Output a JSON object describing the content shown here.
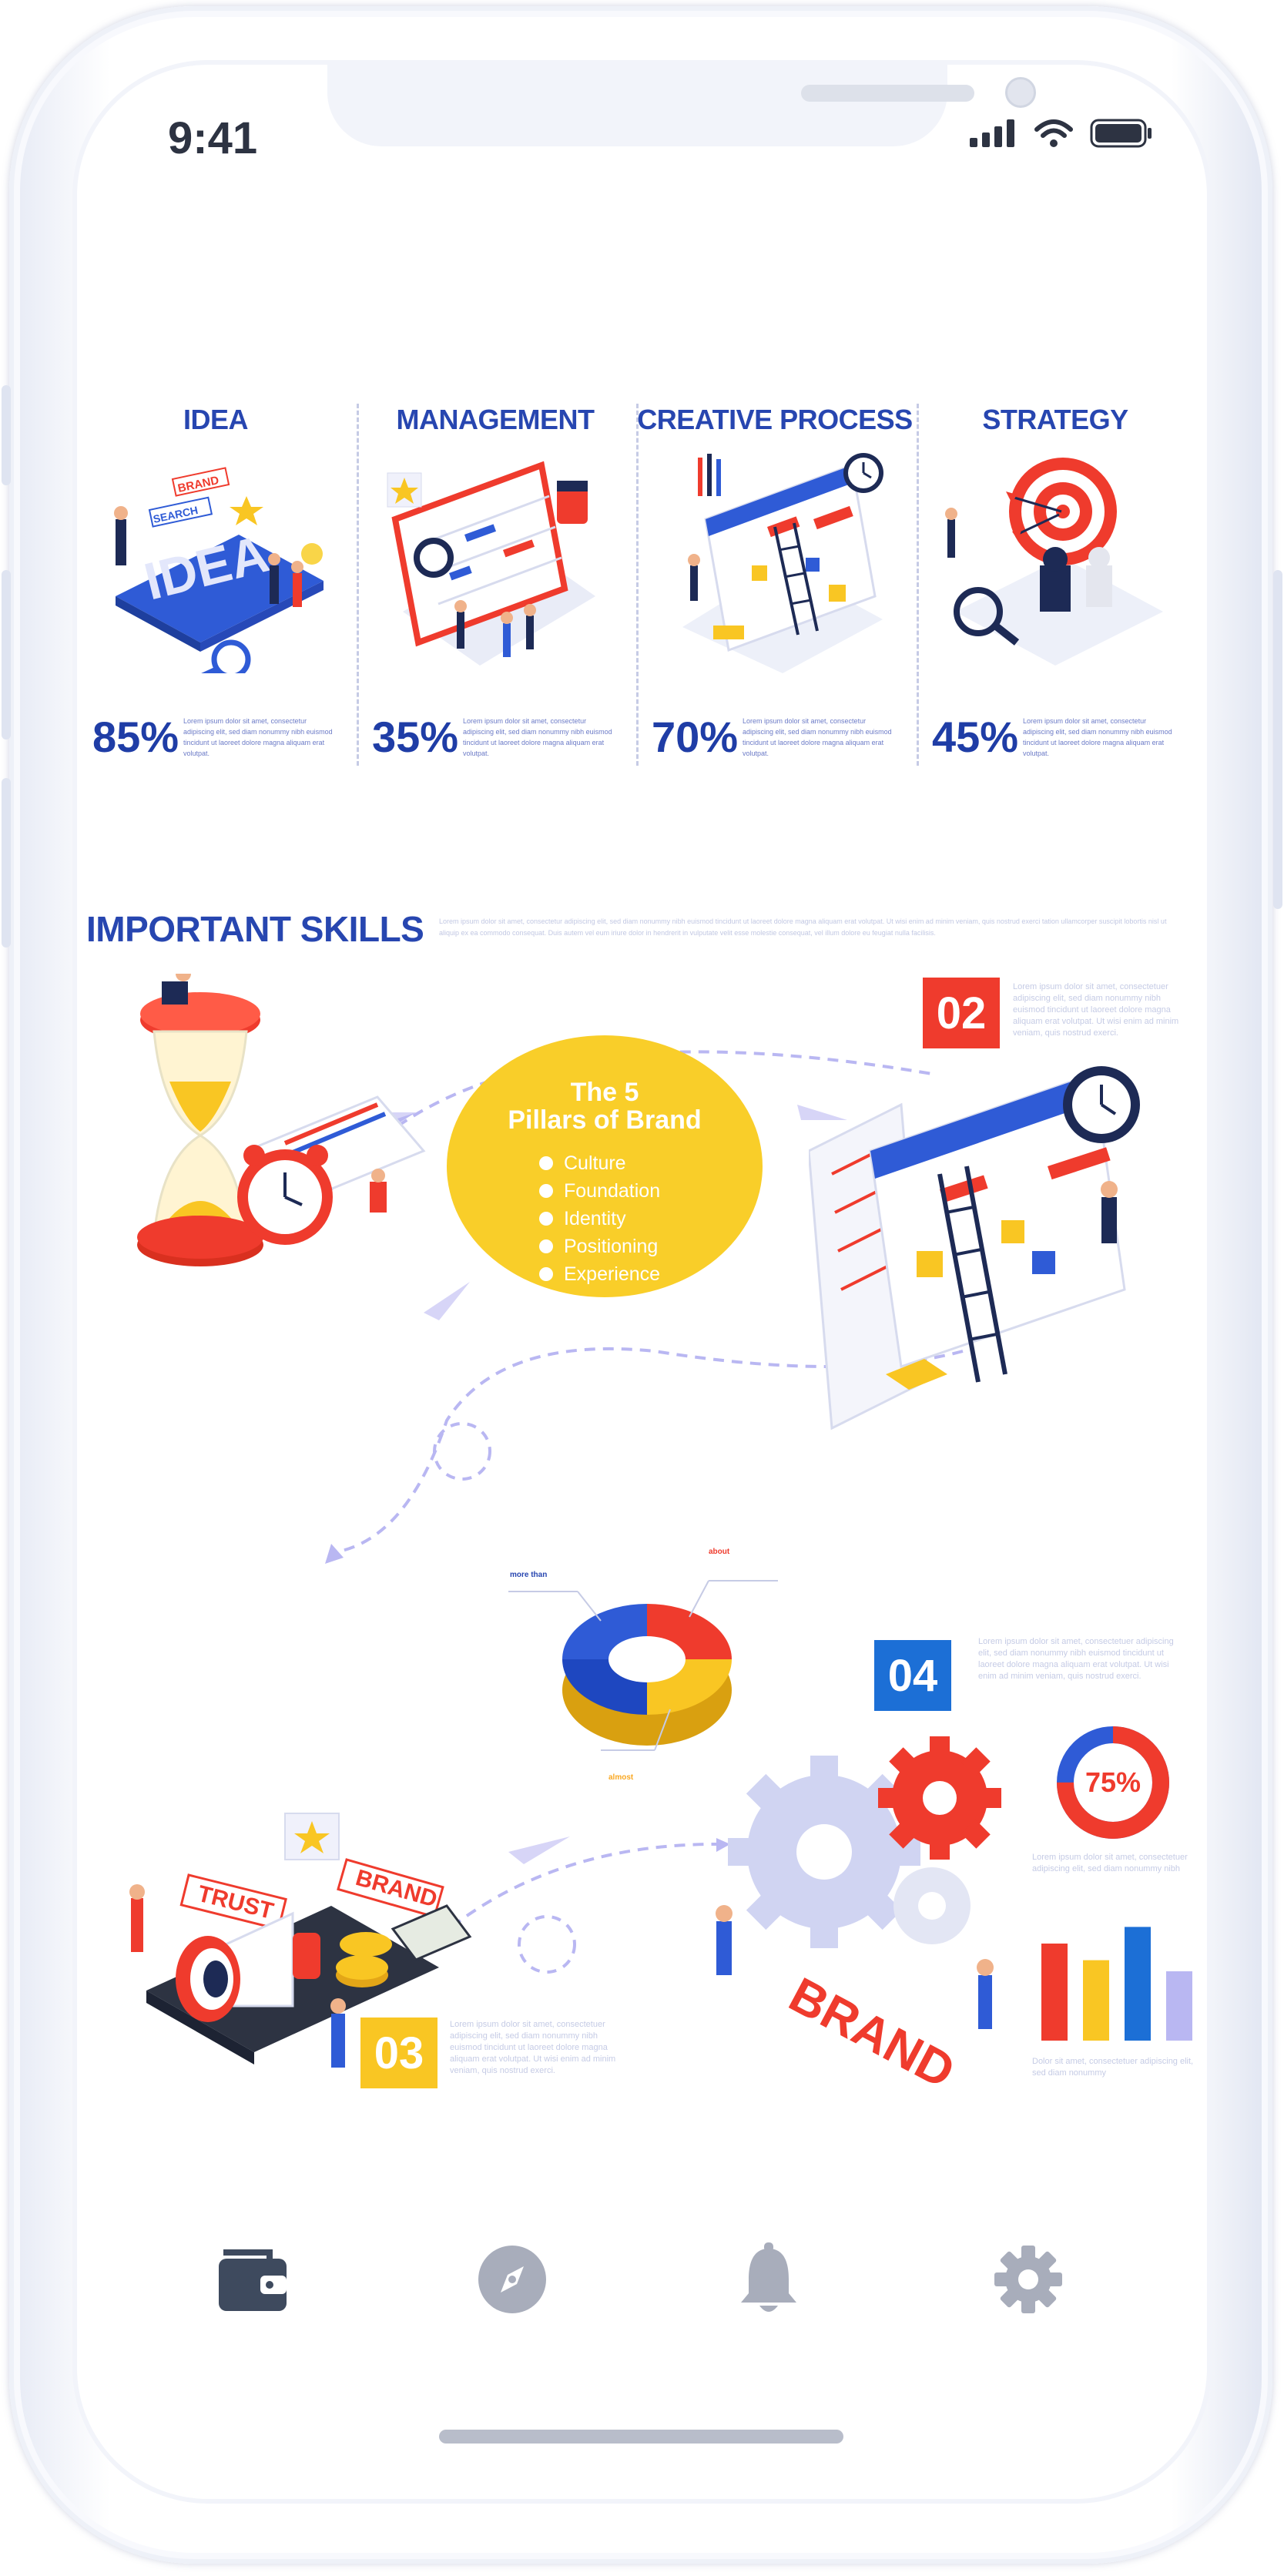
{
  "status_bar": {
    "time": "9:41"
  },
  "categories": [
    {
      "title": "IDEA",
      "percent": "85%",
      "text": "Lorem ipsum dolor sit amet, consectetur adipiscing elit, sed diam nonummy nibh euismod tincidunt ut laoreet dolore magna aliquam erat volutpat."
    },
    {
      "title": "MANAGEMENT",
      "percent": "35%",
      "text": "Lorem ipsum dolor sit amet, consectetur adipiscing elit, sed diam nonummy nibh euismod tincidunt ut laoreet dolore magna aliquam erat volutpat."
    },
    {
      "title": "CREATIVE PROCESS",
      "percent": "70%",
      "text": "Lorem ipsum dolor sit amet, consectetur adipiscing elit, sed diam nonummy nibh euismod tincidunt ut laoreet dolore magna aliquam erat volutpat."
    },
    {
      "title": "STRATEGY",
      "percent": "45%",
      "text": "Lorem ipsum dolor sit amet, consectetur adipiscing elit, sed diam nonummy nibh euismod tincidunt ut laoreet dolore magna aliquam erat volutpat."
    }
  ],
  "skills": {
    "title": "IMPORTANT SKILLS",
    "text": "Lorem ipsum dolor sit amet, consectetur adipiscing elit, sed diam nonummy nibh euismod tincidunt ut laoreet dolore magna aliquam erat volutpat. Ut wisi enim ad minim veniam, quis nostrud exerci tation ullamcorper suscipit lobortis nisl ut aliquip ex ea commodo consequat. Duis autem vel eum iriure dolor in hendrerit in vulputate velit esse molestie consequat, vel illum dolore eu feugiat nulla facilisis."
  },
  "pillars": {
    "title_line1": "The 5",
    "title_line2": "Pillars of Brand",
    "items": [
      "Culture",
      "Foundation",
      "Identity",
      "Positioning",
      "Experience"
    ]
  },
  "steps": [
    {
      "number": "02",
      "color": "#ef3b2d",
      "text": "Lorem ipsum dolor sit amet, consectetuer adipiscing elit, sed diam nonummy nibh euismod tincidunt ut laoreet dolore magna aliquam erat volutpat. Ut wisi enim ad minim veniam, quis nostrud exerci."
    },
    {
      "number": "03",
      "color": "#f9c623",
      "text": "Lorem ipsum dolor sit amet, consectetuer adipiscing elit, sed diam nonummy nibh euismod tincidunt ut laoreet dolore magna aliquam erat volutpat. Ut wisi enim ad minim veniam, quis nostrud exerci."
    },
    {
      "number": "04",
      "color": "#1c6fd6",
      "text": "Lorem ipsum dolor sit amet, consectetuer adipiscing elit, sed diam nonummy nibh euismod tincidunt ut laoreet dolore magna aliquam erat volutpat. Ut wisi enim ad minim veniam, quis nostrud exerci."
    }
  ],
  "ring_chart": {
    "labels": {
      "more_than": "more than",
      "about": "about",
      "almost": "almost"
    }
  },
  "stats": {
    "donut_percent": "75%",
    "donut_value": 0.75,
    "donut_text": "Lorem ipsum dolor sit amet, consectetuer adipiscing elit, sed diam nonummy nibh",
    "bar_text": "Dolor sit amet, consectetuer adipiscing elit, sed diam nonummy",
    "bars": [
      {
        "value": 0.7,
        "color": "#ef3b2d"
      },
      {
        "value": 0.58,
        "color": "#f9c623"
      },
      {
        "value": 0.82,
        "color": "#1c6fd6"
      },
      {
        "value": 0.5,
        "color": "#b9b7f2"
      }
    ]
  },
  "illustration_labels": {
    "brand": "BRAND",
    "search": "SEARCH",
    "idea": "IDEA",
    "trust": "TRUST"
  },
  "nav": {
    "items": [
      {
        "name": "wallet",
        "icon": "wallet-icon"
      },
      {
        "name": "explore",
        "icon": "compass-icon"
      },
      {
        "name": "notifications",
        "icon": "bell-icon"
      },
      {
        "name": "settings",
        "icon": "gear-icon"
      }
    ]
  },
  "colors": {
    "accent_blue": "#2746b0",
    "accent_red": "#ef3b2d",
    "accent_yellow": "#f9c623",
    "nav_icon": "#a8adbb",
    "nav_active": "#3e4a5e"
  }
}
